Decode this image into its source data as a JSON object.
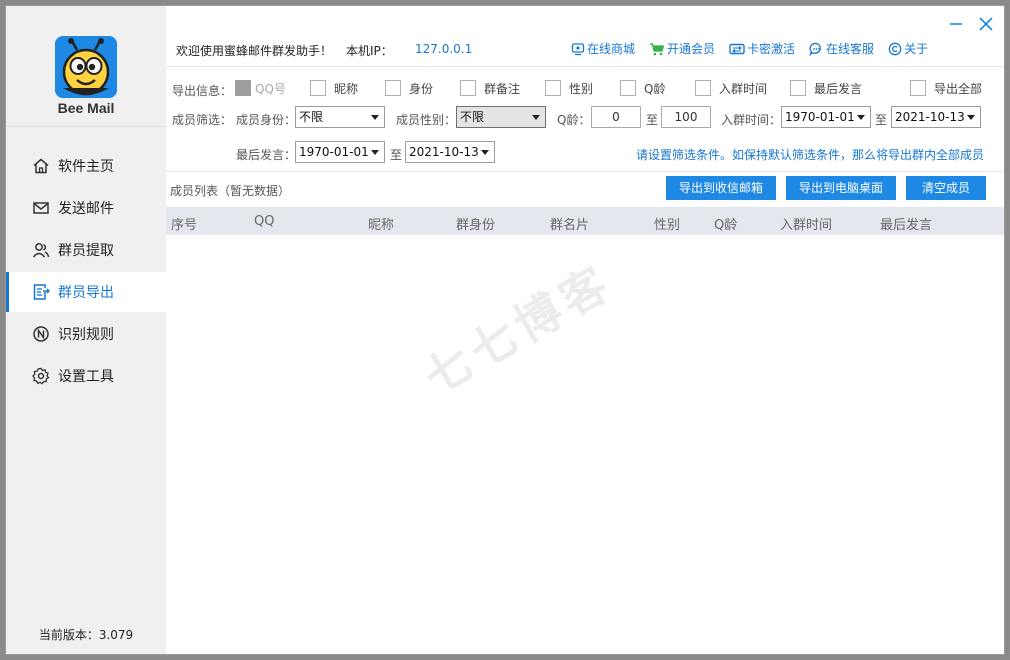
{
  "app": {
    "name": "Bee Mail",
    "version_text": "当前版本：3.079"
  },
  "sidebar": {
    "items": [
      {
        "label": "软件主页",
        "icon": "home-icon"
      },
      {
        "label": "发送邮件",
        "icon": "mail-icon"
      },
      {
        "label": "群员提取",
        "icon": "users-icon"
      },
      {
        "label": "群员导出",
        "icon": "export-icon",
        "active": true
      },
      {
        "label": "识别规则",
        "icon": "rule-icon"
      },
      {
        "label": "设置工具",
        "icon": "gear-icon"
      }
    ]
  },
  "header": {
    "welcome": "欢迎使用蜜蜂邮件群发助手！",
    "ip_label": "本机IP：",
    "ip_value": "127.0.0.1",
    "links": [
      {
        "label": "在线商城",
        "icon": "shop-icon"
      },
      {
        "label": "开通会员",
        "icon": "cart-icon"
      },
      {
        "label": "卡密激活",
        "icon": "card-icon"
      },
      {
        "label": "在线客服",
        "icon": "service-icon"
      },
      {
        "label": "关于",
        "icon": "copyright-icon"
      }
    ]
  },
  "export_info": {
    "label": "导出信息：",
    "options": [
      "QQ号",
      "昵称",
      "身份",
      "群备注",
      "性别",
      "Q龄",
      "入群时间",
      "最后发言"
    ],
    "export_all": "导出全部"
  },
  "filter": {
    "label": "成员筛选：",
    "role_label": "成员身份：",
    "role_value": "不限",
    "gender_label": "成员性别：",
    "gender_value": "不限",
    "qage_label": "Q龄：",
    "qage_min": "0",
    "to": "至",
    "qage_max": "100",
    "join_label": "入群时间：",
    "join_from": "1970-01-01",
    "join_to": "2021-10-13",
    "last_label": "最后发言：",
    "last_from": "1970-01-01",
    "last_to": "2021-10-13",
    "hint": "请设置筛选条件。如保持默认筛选条件，那么将导出群内全部成员"
  },
  "list": {
    "title": "成员列表（暂无数据）",
    "buttons": {
      "to_mail": "导出到收信邮箱",
      "to_desktop": "导出到电脑桌面",
      "clear": "清空成员"
    },
    "columns": [
      "序号",
      "QQ",
      "昵称",
      "群身份",
      "群名片",
      "性别",
      "Q龄",
      "入群时间",
      "最后发言"
    ]
  },
  "watermark": "七七博客",
  "colors": {
    "accent": "#1e88e5",
    "link": "#1677d2",
    "sidebar_bg": "#f0f0f0",
    "table_header": "#e4e8ee"
  }
}
